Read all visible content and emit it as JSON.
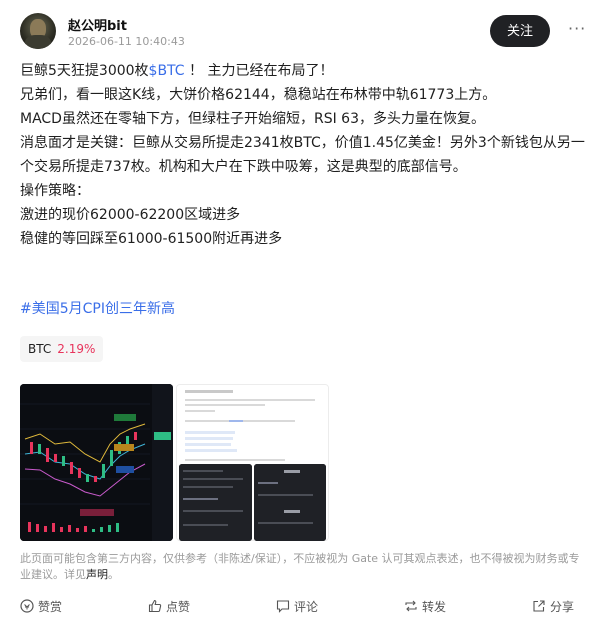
{
  "header": {
    "author": "赵公明bit",
    "timestamp": "2026-06-11 10:40:43",
    "follow_label": "关注",
    "more_icon": "more-horizontal-icon"
  },
  "post": {
    "line1_prefix": "巨鲸5天狂提3000枚",
    "line1_ticker": "$BTC",
    "line1_suffix": " ！ 主力已经在布局了！",
    "line2": "兄弟们，看一眼这K线，大饼价格62144，稳稳站在布林带中轨61773上方。",
    "line3": "MACD虽然还在零轴下方，但绿柱子开始缩短，RSI 63，多头力量在恢复。",
    "line4": "消息面才是关键：巨鲸从交易所提走2341枚BTC，价值1.45亿美金！另外3个新钱包从另一个交易所提走737枚。机构和大户在下跌中吸筹，这是典型的底部信号。",
    "line5": "操作策略：",
    "line6": "激进的现价62000-62200区域进多",
    "line7": "稳健的等回踩至61000-61500附近再进多"
  },
  "hashtag": "#美国5月CPI创三年新高",
  "chip": {
    "symbol": "BTC",
    "change": "2.19%",
    "change_color": "#e8345c"
  },
  "disclaimer": {
    "text": "此页面可能包含第三方内容，仅供参考（非陈述/保证），不应被视为 Gate 认可其观点表述，也不得被视为财务或专业建议。详见",
    "link": "声明",
    "end": "。"
  },
  "actions": [
    {
      "label": "赞赏",
      "icon": "reward-icon"
    },
    {
      "label": "点赞",
      "icon": "thumbs-up-icon"
    },
    {
      "label": "评论",
      "icon": "comment-icon"
    },
    {
      "label": "转发",
      "icon": "repost-icon"
    },
    {
      "label": "分享",
      "icon": "share-icon"
    }
  ]
}
